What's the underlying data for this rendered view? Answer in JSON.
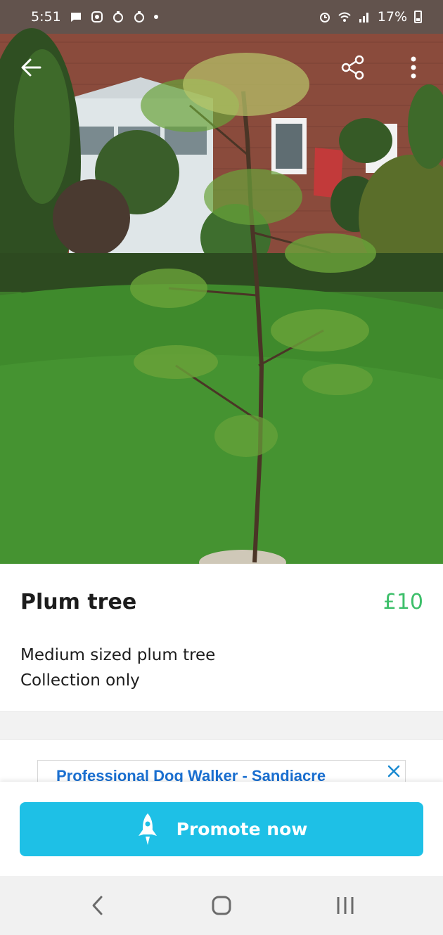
{
  "status_bar": {
    "time": "5:51",
    "battery_percent": "17%",
    "icons": [
      "message-icon",
      "notification-icon",
      "app-icon",
      "app-icon",
      "dot-icon",
      "alarm-icon",
      "wifi-icon",
      "signal-icon",
      "battery-icon"
    ]
  },
  "photo": {
    "description_icon": "plum-tree-photo",
    "actions": {
      "back": "back-arrow-icon",
      "share": "share-icon",
      "more": "more-vertical-icon"
    }
  },
  "listing": {
    "title": "Plum tree",
    "price": "£10",
    "description_lines": [
      "Medium sized plum tree",
      "Collection only"
    ]
  },
  "ad": {
    "text": "Professional Dog Walker - Sandiacre",
    "close_icon": "close-icon"
  },
  "promote_button": {
    "label": "Promote now",
    "icon": "rocket-icon"
  },
  "navbar": {
    "items": [
      "back-icon",
      "home-icon",
      "recents-icon"
    ]
  },
  "colors": {
    "price": "#3dbf6a",
    "promote_button": "#1ec0e6",
    "ad_link": "#1a6fd0"
  }
}
